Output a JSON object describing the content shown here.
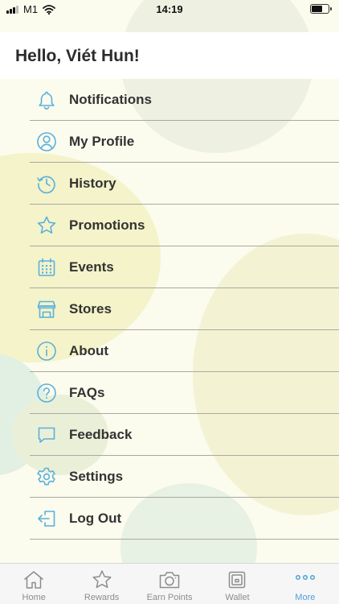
{
  "status_bar": {
    "carrier": "M1",
    "time": "14:19",
    "battery_level": 0.6
  },
  "header": {
    "greeting": "Hello, Viét Hun!"
  },
  "menu": {
    "items": [
      {
        "label": "Notifications",
        "icon": "bell-icon"
      },
      {
        "label": "My Profile",
        "icon": "user-circle-icon"
      },
      {
        "label": "History",
        "icon": "history-clock-icon"
      },
      {
        "label": "Promotions",
        "icon": "star-icon"
      },
      {
        "label": "Events",
        "icon": "calendar-icon"
      },
      {
        "label": "Stores",
        "icon": "store-icon"
      },
      {
        "label": "About",
        "icon": "info-icon"
      },
      {
        "label": "FAQs",
        "icon": "question-icon"
      },
      {
        "label": "Feedback",
        "icon": "chat-bubble-icon"
      },
      {
        "label": "Settings",
        "icon": "gear-icon"
      },
      {
        "label": "Log Out",
        "icon": "logout-icon"
      }
    ]
  },
  "tab_bar": {
    "active_tab": "More",
    "tabs": [
      {
        "label": "Home",
        "icon": "home-icon"
      },
      {
        "label": "Rewards",
        "icon": "star-icon"
      },
      {
        "label": "Earn Points",
        "icon": "camera-icon"
      },
      {
        "label": "Wallet",
        "icon": "wallet-icon"
      },
      {
        "label": "More",
        "icon": "more-dots-icon"
      }
    ]
  },
  "colors": {
    "accent": "#4aa3d8",
    "icon_blue": "#5ab0de",
    "background": "#fbfbee",
    "tab_inactive": "#8c8c8c",
    "text": "#333333"
  }
}
